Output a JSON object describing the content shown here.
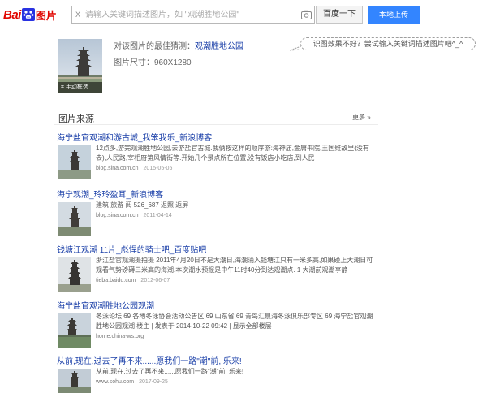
{
  "header": {
    "logo_bai": "Bai",
    "logo_du": "du",
    "logo_tupian": "图片",
    "clear_label": "X",
    "search_placeholder": "请输入关键词描述图片，如 \"观潮胜地公园\"",
    "search_button": "百度一下",
    "upload_button": "本地上传"
  },
  "summary": {
    "guess_prefix": "对该图片的最佳猜测：",
    "guess_value": "观潮胜地公园",
    "size_prefix": "图片尺寸：",
    "size_value": "960X1280",
    "manual_crop_label": "手动框选",
    "hint_bubble": "识图效果不好？尝试输入关键词描述图片吧^_^"
  },
  "sources": {
    "title": "图片来源",
    "more": "更多 »",
    "items": [
      {
        "title": "海宁盐官观潮和游古城_我笨我乐_新浪博客",
        "snippet": "12点多,游完观潮胜地公园,去游盐官古城.我俩按这样的顺序游:海神庙,金庸书院,王国维故里(没有去),人民路,宰相府第风情街等.开始几个景点所在位置,没有饭店小吃店,到人民",
        "site": "blog.sina.com.cn",
        "date": "2015-05-05"
      },
      {
        "title": "海宁观潮_玲玲盈耳_新浪博客",
        "snippet": "建筑 旅游 阅 526_687 返照 返屏",
        "site": "blog.sina.com.cn",
        "date": "2011-04-14"
      },
      {
        "title": "钱塘江观潮 11片_彪悍的骑士吧_百度贴吧",
        "snippet": "浙江盐官观潮摄拍摄 2011年4月20日不是大潮日,海潮涌入钱塘江只有一米多高,如果碰上大潮日可观看气势磅礴三米高的海潮.本次潮水预报是中午11时40分到达观潮点. 1 大潮前观潮亭静",
        "site": "tieba.baidu.com",
        "date": "2012-06-07"
      },
      {
        "title": "海宁盐官观潮胜地公园观潮",
        "snippet": "冬泳论坛 69 各地冬泳协会活动公告区 69 山东省 69 青岛汇泉海冬泳俱乐部专区 69 海宁盐官观潮胜地公园观潮 楼主 | 发表于 2014-10-22 09:42 | 显示全部楼层",
        "site": "home.china-ws.org",
        "date": ""
      },
      {
        "title": "从前,现在,过去了再不来......愿我们一路\"潮\"前, 乐来!",
        "snippet": "从前,现在,过去了再不来......愿我们一路\"潮\"前, 乐来!",
        "site": "www.sohu.com",
        "date": "2017-09-25"
      }
    ]
  }
}
